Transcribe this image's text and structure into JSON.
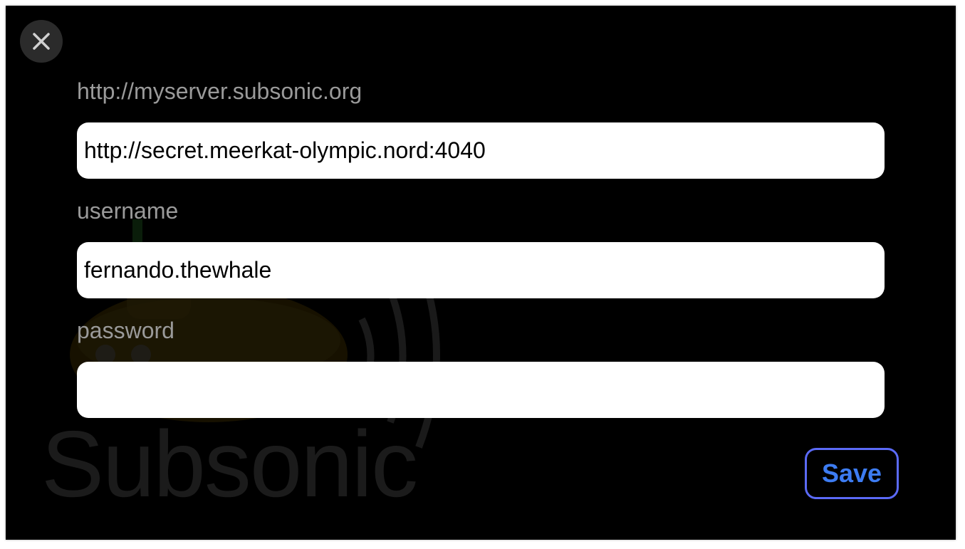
{
  "dialog": {
    "close_icon": "close-icon",
    "background_logo_text": "Subsonic",
    "fields": {
      "server": {
        "label": "http://myserver.subsonic.org",
        "value": "http://secret.meerkat-olympic.nord:4040"
      },
      "username": {
        "label": "username",
        "value": "fernando.thewhale"
      },
      "password": {
        "label": "password",
        "value": ""
      }
    },
    "save_label": "Save"
  },
  "colors": {
    "background": "#000000",
    "label": "#9a9a9a",
    "save_text": "#3d7cf2",
    "save_border": "#5b6af7",
    "close_button_bg": "#2b2b2b"
  }
}
